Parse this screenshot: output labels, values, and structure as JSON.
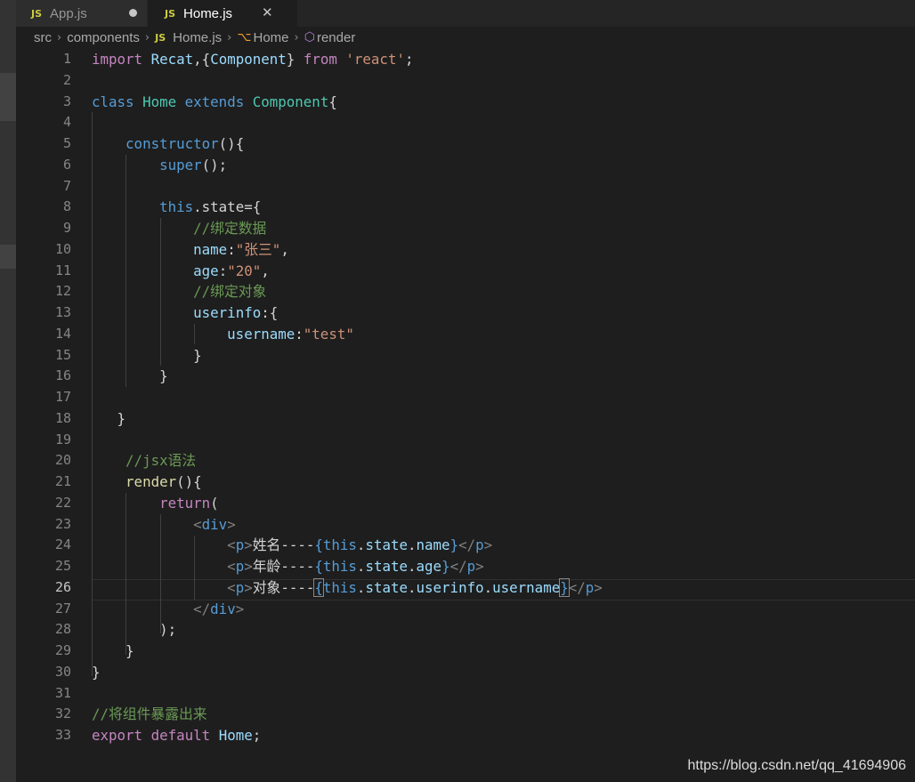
{
  "tabs": [
    {
      "icon": "JS",
      "label": "App.js",
      "dirty": true
    },
    {
      "icon": "JS",
      "label": "Home.js",
      "close": "✕"
    }
  ],
  "breadcrumb": {
    "items": [
      "src",
      "components",
      "Home.js",
      "Home",
      "render"
    ],
    "file_icon": "JS"
  },
  "editor": {
    "current_line": 26,
    "line_numbers": [
      "1",
      "2",
      "3",
      "4",
      "5",
      "6",
      "7",
      "8",
      "9",
      "10",
      "11",
      "12",
      "13",
      "14",
      "15",
      "16",
      "17",
      "18",
      "19",
      "20",
      "21",
      "22",
      "23",
      "24",
      "25",
      "26",
      "27",
      "28",
      "29",
      "30",
      "31",
      "32",
      "33"
    ],
    "code": {
      "l1": [
        "import",
        "Recat",
        ",{",
        "Component",
        "}",
        "from",
        "'react'",
        ";"
      ],
      "l3": [
        "class",
        "Home",
        "extends",
        "Component",
        "{"
      ],
      "l5": [
        "constructor",
        "(){"
      ],
      "l6": [
        "super",
        "();"
      ],
      "l8": [
        "this",
        ".state={"
      ],
      "l9": "//绑定数据",
      "l10": [
        "name",
        ":",
        "\"张三\"",
        ","
      ],
      "l11": [
        "age",
        ":",
        "\"20\"",
        ","
      ],
      "l12": "//绑定对象",
      "l13": [
        "userinfo",
        ":{"
      ],
      "l14": [
        "username",
        ":",
        "\"test\""
      ],
      "l15": "}",
      "l16": "}",
      "l18": "}",
      "l20": "//jsx语法",
      "l21": [
        "render",
        "(){"
      ],
      "l22": [
        "return",
        "("
      ],
      "l23": [
        "<",
        "div",
        ">"
      ],
      "l24": [
        "<",
        "p",
        ">",
        "姓名----",
        "{",
        "this",
        ".",
        "state",
        ".",
        "name",
        "}",
        "</",
        "p",
        ">"
      ],
      "l25": [
        "<",
        "p",
        ">",
        "年龄----",
        "{",
        "this",
        ".",
        "state",
        ".",
        "age",
        "}",
        "</",
        "p",
        ">"
      ],
      "l26": [
        "<",
        "p",
        ">",
        "对象----",
        "{",
        "this",
        ".",
        "state",
        ".",
        "userinfo",
        ".",
        "username",
        "}",
        "</",
        "p",
        ">"
      ],
      "l27": [
        "</",
        "div",
        ">"
      ],
      "l28": ");",
      "l29": "}",
      "l30": "}",
      "l32": "//将组件暴露出来",
      "l33": [
        "export",
        "default",
        "Home",
        ";"
      ]
    }
  },
  "watermark": "https://blog.csdn.net/qq_41694906"
}
